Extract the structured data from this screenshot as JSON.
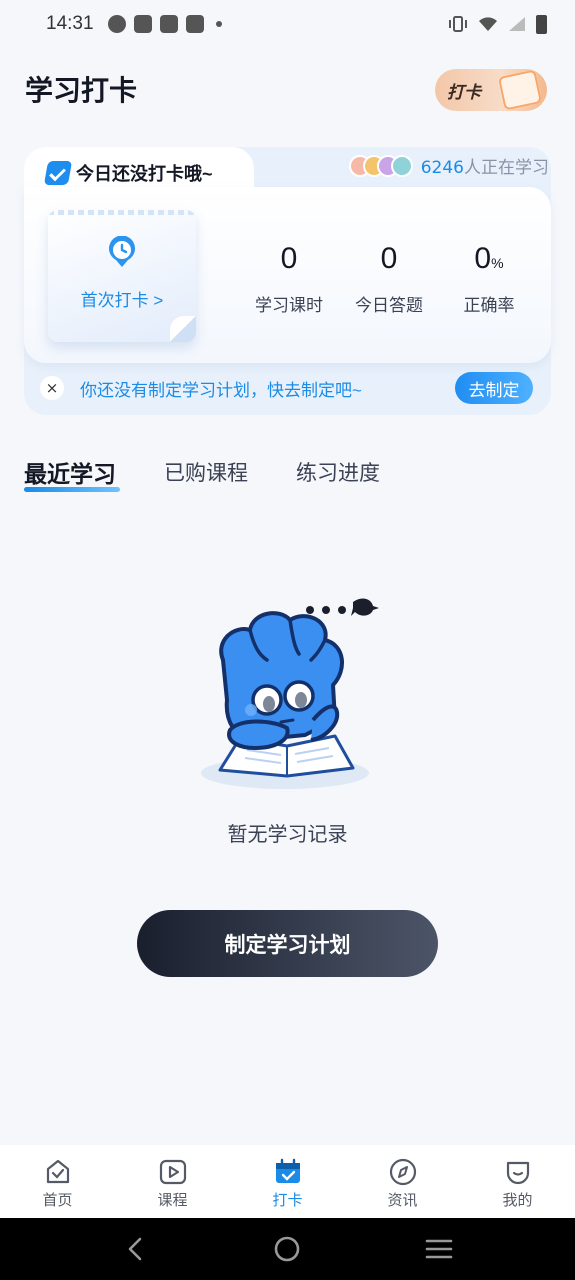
{
  "status_bar": {
    "time": "14:31"
  },
  "header": {
    "title": "学习打卡",
    "checkin_badge": "打卡"
  },
  "checkin_card": {
    "title": "今日还没打卡哦~",
    "learners_count": "6246",
    "learners_suffix": "人正在学习",
    "first_checkin_label": "首次打卡 >",
    "stats": [
      {
        "value": "0",
        "unit": "",
        "label": "学习课时"
      },
      {
        "value": "0",
        "unit": "",
        "label": "今日答题"
      },
      {
        "value": "0",
        "unit": "%",
        "label": "正确率"
      }
    ],
    "plan_notice": "你还没有制定学习计划，快去制定吧~",
    "plan_button": "去制定",
    "close_symbol": "×"
  },
  "tabs": [
    {
      "label": "最近学习",
      "active": true
    },
    {
      "label": "已购课程",
      "active": false
    },
    {
      "label": "练习进度",
      "active": false
    }
  ],
  "empty_state": {
    "text": "暂无学习记录",
    "button": "制定学习计划"
  },
  "bottom_nav": [
    {
      "label": "首页",
      "icon": "home-icon"
    },
    {
      "label": "课程",
      "icon": "play-icon"
    },
    {
      "label": "打卡",
      "icon": "calendar-check-icon",
      "active": true
    },
    {
      "label": "资讯",
      "icon": "compass-icon"
    },
    {
      "label": "我的",
      "icon": "profile-icon"
    }
  ],
  "colors": {
    "accent": "#1a8be6",
    "background": "#f5f7fb",
    "dark_button": "#1a1f2e"
  }
}
